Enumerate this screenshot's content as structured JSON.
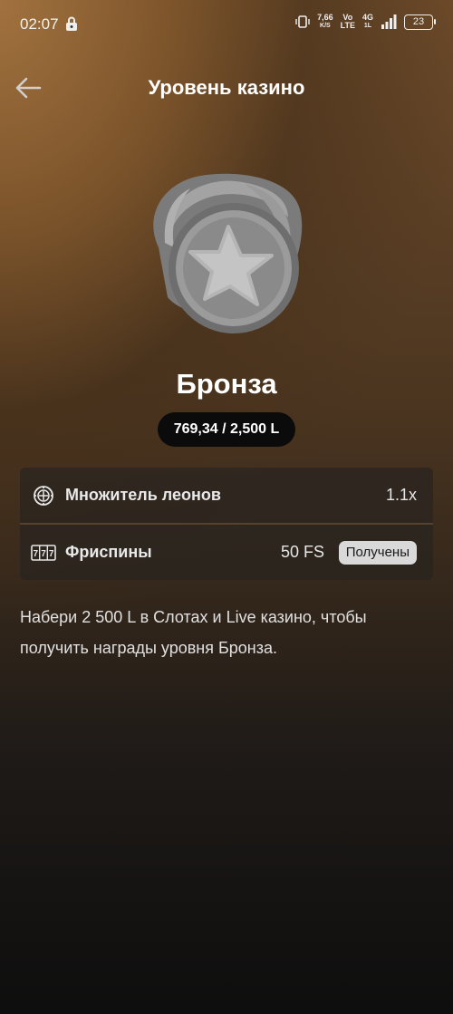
{
  "status_bar": {
    "time": "02:07",
    "net_speed_value": "7,66",
    "net_speed_unit": "K/S",
    "volte_top": "Vo",
    "volte_bottom": "LTE",
    "network_top": "4G",
    "network_bottom": "1L",
    "battery": "23"
  },
  "header": {
    "title": "Уровень казино"
  },
  "level": {
    "name": "Бронза",
    "progress_text": "769,34 / 2,500 L"
  },
  "rewards": [
    {
      "icon": "roulette-icon",
      "label": "Множитель леонов",
      "value": "1.1x"
    },
    {
      "icon": "slot-machine-icon",
      "label": "Фриспины",
      "value": "50 FS",
      "tag": "Получены"
    }
  ],
  "slot_icon_text": "777",
  "description": "Набери 2 500 L в Слотах и Live казино, чтобы получить награды уровня Бронза.",
  "colors": {
    "pill_bg": "#0b0b0b",
    "card_bg": "#28241f",
    "tag_bg": "#d9d9d9",
    "badge_grey": "#8c8c8c"
  }
}
